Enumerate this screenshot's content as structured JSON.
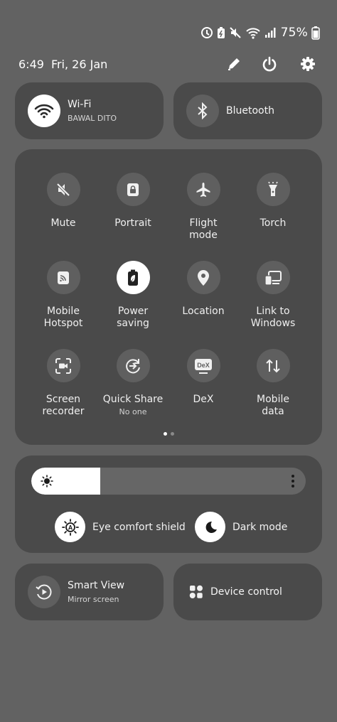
{
  "status_bar": {
    "battery_percent": "75%",
    "icons": [
      "data-saver-icon",
      "battery-saver-icon",
      "mute-icon",
      "wifi-calling-icon",
      "signal-icon",
      "battery-icon"
    ]
  },
  "header": {
    "time": "6:49",
    "date": "Fri, 26 Jan",
    "actions": [
      "pencil-icon",
      "power-icon",
      "gear-icon"
    ]
  },
  "wifi": {
    "title": "Wi-Fi",
    "network": "BAWAL DITO",
    "enabled": true
  },
  "bluetooth": {
    "title": "Bluetooth",
    "enabled": false
  },
  "tiles": [
    {
      "label": "Mute",
      "sub": "",
      "icon": "mute-icon",
      "enabled": false
    },
    {
      "label": "Portrait",
      "sub": "",
      "icon": "portrait-lock-icon",
      "enabled": false
    },
    {
      "label": "Flight\nmode",
      "sub": "",
      "icon": "airplane-icon",
      "enabled": false
    },
    {
      "label": "Torch",
      "sub": "",
      "icon": "torch-icon",
      "enabled": false
    },
    {
      "label": "Mobile\nHotspot",
      "sub": "",
      "icon": "hotspot-icon",
      "enabled": false
    },
    {
      "label": "Power\nsaving",
      "sub": "",
      "icon": "power-saving-icon",
      "enabled": true
    },
    {
      "label": "Location",
      "sub": "",
      "icon": "location-pin-icon",
      "enabled": false
    },
    {
      "label": "Link to\nWindows",
      "sub": "",
      "icon": "link-to-windows-icon",
      "enabled": false
    },
    {
      "label": "Screen\nrecorder",
      "sub": "",
      "icon": "screen-recorder-icon",
      "enabled": false
    },
    {
      "label": "Quick Share",
      "sub": "No one",
      "icon": "quick-share-icon",
      "enabled": false
    },
    {
      "label": "DeX",
      "sub": "",
      "icon": "dex-icon",
      "icon_text": "DeX",
      "enabled": false
    },
    {
      "label": "Mobile\ndata",
      "sub": "",
      "icon": "mobile-data-icon",
      "enabled": false
    }
  ],
  "pager": {
    "pages": 2,
    "current": 1
  },
  "brightness": {
    "level": 0.25
  },
  "eye_comfort": {
    "label": "Eye comfort shield"
  },
  "dark_mode": {
    "label": "Dark mode"
  },
  "smart_view": {
    "title": "Smart View",
    "sub": "Mirror screen"
  },
  "device_control": {
    "title": "Device control"
  },
  "colors": {
    "background": "#626262",
    "card": "#4a4a4a",
    "tile_off": "#5f5f5f",
    "tile_on": "#ffffff"
  }
}
